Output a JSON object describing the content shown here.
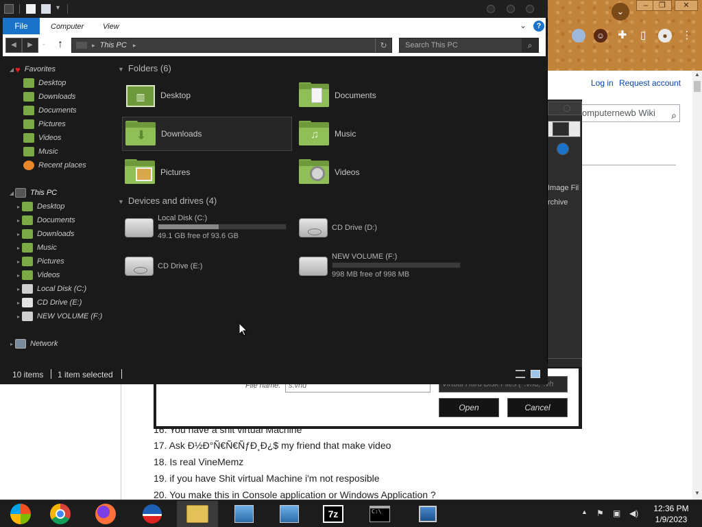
{
  "browser": {
    "login_link": "Log in",
    "request_link": "Request account",
    "search_value": "omputernewb Wiki",
    "list_items": [
      "16. You have a shit virtual Machine",
      "17. Ask Ð½Ð°Ñ€Ñ€ÑƒÐ¸Ð¿$ my friend that make video",
      "18. Is real VineMemz",
      "19. if you have Shit virtual Machine i'm not resposible",
      "20. You make this in Console application or Windows Application ?"
    ]
  },
  "bg_dialog": {
    "file_name_label": "File name:",
    "file_name_value": "s.vhd",
    "filter_text": "Virtual Hard Disk Files (*.vhd;*.vh",
    "open_label": "Open",
    "cancel_label": "Cancel",
    "side_text_1": "Image Fil",
    "side_text_2": "rchive"
  },
  "explorer": {
    "tabs": {
      "file": "File",
      "computer": "Computer",
      "view": "View"
    },
    "address": "This PC",
    "search_placeholder": "Search This PC",
    "nav": {
      "favorites": "Favorites",
      "favorites_items": [
        "Desktop",
        "Downloads",
        "Documents",
        "Pictures",
        "Videos",
        "Music",
        "Recent places"
      ],
      "this_pc": "This PC",
      "this_pc_items": [
        "Desktop",
        "Documents",
        "Downloads",
        "Music",
        "Pictures",
        "Videos",
        "Local Disk (C:)",
        "CD Drive (E:)",
        "NEW VOLUME (F:)"
      ],
      "network": "Network"
    },
    "folders_header": "Folders (6)",
    "folders": [
      "Desktop",
      "Documents",
      "Downloads",
      "Music",
      "Pictures",
      "Videos"
    ],
    "drives_header": "Devices and drives (4)",
    "drives": {
      "c_name": "Local Disk (C:)",
      "c_free": "49.1 GB free of 93.6 GB",
      "c_used_fraction": 0.475,
      "d_name": "CD Drive (D:)",
      "e_name": "CD Drive (E:)",
      "f_name": "NEW VOLUME (F:)",
      "f_free": "998 MB free of 998 MB",
      "f_used_fraction": 0.0
    },
    "status": {
      "items": "10 items",
      "selected": "1 item selected"
    }
  },
  "taskbar": {
    "apps": [
      "start-orb",
      "chrome",
      "firefox",
      "obama-app",
      "file-explorer",
      "setup-app-1",
      "setup-app-2",
      "7zip",
      "cmd",
      "control-panel"
    ],
    "time": "12:36 PM",
    "date": "1/9/2023"
  },
  "colors": {
    "accent": "#1a73c9",
    "folder_green": "#8fbf56",
    "window_bg": "#1a1a1a"
  }
}
